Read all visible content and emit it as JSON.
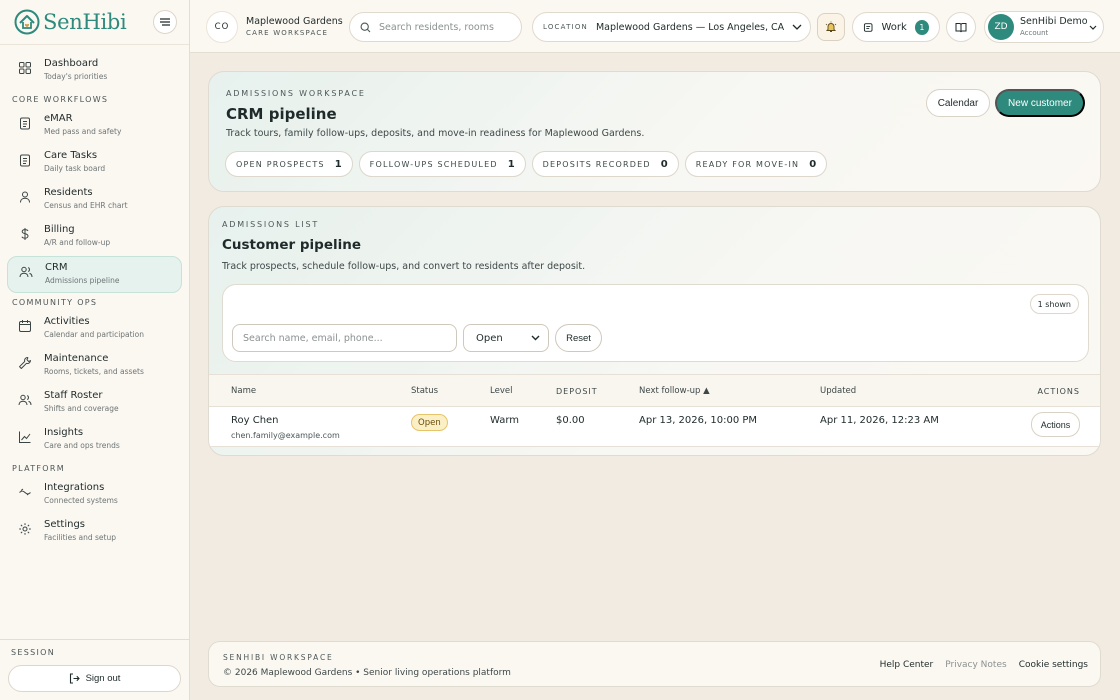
{
  "brand": {
    "name": "SenHibi"
  },
  "sidebar": {
    "sections": {
      "core": "CORE WORKFLOWS",
      "community": "COMMUNITY OPS",
      "platform": "PLATFORM"
    },
    "items": [
      {
        "title": "Dashboard",
        "sub": "Today's priorities",
        "icon": "dashboard-icon"
      },
      {
        "title": "eMAR",
        "sub": "Med pass and safety",
        "icon": "clipboard-icon"
      },
      {
        "title": "Care Tasks",
        "sub": "Daily task board",
        "icon": "task-icon"
      },
      {
        "title": "Residents",
        "sub": "Census and EHR chart",
        "icon": "person-icon"
      },
      {
        "title": "Billing",
        "sub": "A/R and follow-up",
        "icon": "dollar-icon"
      },
      {
        "title": "CRM",
        "sub": "Admissions pipeline",
        "icon": "people-icon"
      },
      {
        "title": "Activities",
        "sub": "Calendar and participation",
        "icon": "calendar-icon"
      },
      {
        "title": "Maintenance",
        "sub": "Rooms, tickets, and assets",
        "icon": "wrench-icon"
      },
      {
        "title": "Staff Roster",
        "sub": "Shifts and coverage",
        "icon": "staff-icon"
      },
      {
        "title": "Insights",
        "sub": "Care and ops trends",
        "icon": "chart-icon"
      },
      {
        "title": "Integrations",
        "sub": "Connected systems",
        "icon": "link-icon"
      },
      {
        "title": "Settings",
        "sub": "Facilities and setup",
        "icon": "gear-icon"
      }
    ],
    "active_index": 5,
    "session_label": "SESSION",
    "signout_label": "Sign out"
  },
  "topbar": {
    "workspace_badge": "CO",
    "workspace_name": "Maplewood Gardens",
    "workspace_sub": "CARE WORKSPACE",
    "search_placeholder": "Search residents, rooms",
    "location_label": "LOCATION",
    "location_value": "Maplewood Gardens — Los Angeles, CA",
    "work_label": "Work",
    "work_count": "1",
    "account_initials": "ZD",
    "account_name": "SenHibi Demo",
    "account_role": "Account"
  },
  "hero": {
    "eyebrow": "ADMISSIONS WORKSPACE",
    "title": "CRM pipeline",
    "description": "Track tours, family follow-ups, deposits, and move-in readiness for Maplewood Gardens.",
    "calendar_label": "Calendar",
    "new_customer_label": "New customer",
    "stats": [
      {
        "label": "OPEN PROSPECTS",
        "value": "1"
      },
      {
        "label": "FOLLOW-UPS SCHEDULED",
        "value": "1"
      },
      {
        "label": "DEPOSITS RECORDED",
        "value": "0"
      },
      {
        "label": "READY FOR MOVE-IN",
        "value": "0"
      }
    ]
  },
  "list": {
    "eyebrow": "ADMISSIONS LIST",
    "title": "Customer pipeline",
    "description": "Track prospects, schedule follow-ups, and convert to residents after deposit.",
    "shown": "1 shown",
    "search_placeholder": "Search name, email, phone...",
    "status_value": "Open",
    "reset_label": "Reset",
    "columns": {
      "name": "Name",
      "status": "Status",
      "level": "Level",
      "deposit": "DEPOSIT",
      "next_followup": "Next follow-up ▲",
      "updated": "Updated",
      "actions": "ACTIONS"
    },
    "rows": [
      {
        "name": "Roy Chen",
        "email": "chen.family@example.com",
        "status": "Open",
        "level": "Warm",
        "deposit": "$0.00",
        "next_followup": "Apr 13, 2026, 10:00 PM",
        "updated": "Apr 11, 2026, 12:23 AM",
        "actions_label": "Actions"
      }
    ]
  },
  "footer": {
    "eyebrow": "SENHIBI WORKSPACE",
    "copyright": "© 2026 Maplewood Gardens • Senior living operations platform",
    "links": [
      "Help Center",
      "Privacy Notes",
      "Cookie settings"
    ]
  },
  "colors": {
    "accent": "#2e8a7d",
    "background": "#f1ebe1",
    "badge_open": "#fbefc6"
  }
}
